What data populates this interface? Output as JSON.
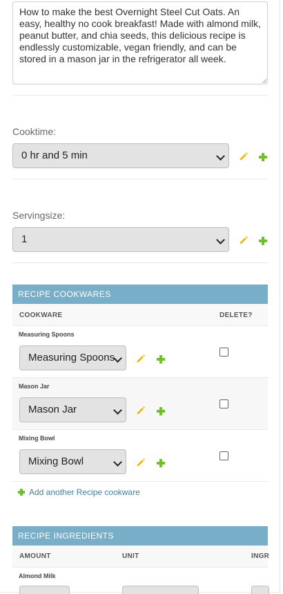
{
  "description": {
    "value": "How to make the best Overnight Steel Cut Oats. An easy, healthy no cook breakfast! Made with almond milk, peanut butter, and chia seeds, this delicious recipe is endlessly customizable, vegan friendly, and can be stored in a mason jar in the refrigerator all week."
  },
  "cooktime": {
    "label": "Cooktime:",
    "selected": "0 hr and 5 min"
  },
  "servingsize": {
    "label": "Servingsize:",
    "selected": "1"
  },
  "cookwares": {
    "caption": "Recipe cookwares",
    "col_cookware": "Cookware",
    "col_delete": "Delete?",
    "rows": [
      {
        "title": "Measuring Spoons",
        "selected": "Measuring Spoons"
      },
      {
        "title": "Mason Jar",
        "selected": "Mason Jar"
      },
      {
        "title": "Mixing Bowl",
        "selected": "Mixing Bowl"
      }
    ],
    "add_link": "Add another Recipe cookware"
  },
  "ingredients": {
    "caption": "Recipe ingredients",
    "col_amount": "Amount",
    "col_unit": "Unit",
    "col_ingredient": "Ingr",
    "first_row_title": "Almond Milk"
  },
  "colors": {
    "module_header": "#79aec8",
    "link": "#447e9b",
    "add_green": "#70bf2b",
    "edit_yellow": "#efb80b"
  },
  "icons": [
    "pencil-icon",
    "plus-icon",
    "chevron-down-icon"
  ]
}
